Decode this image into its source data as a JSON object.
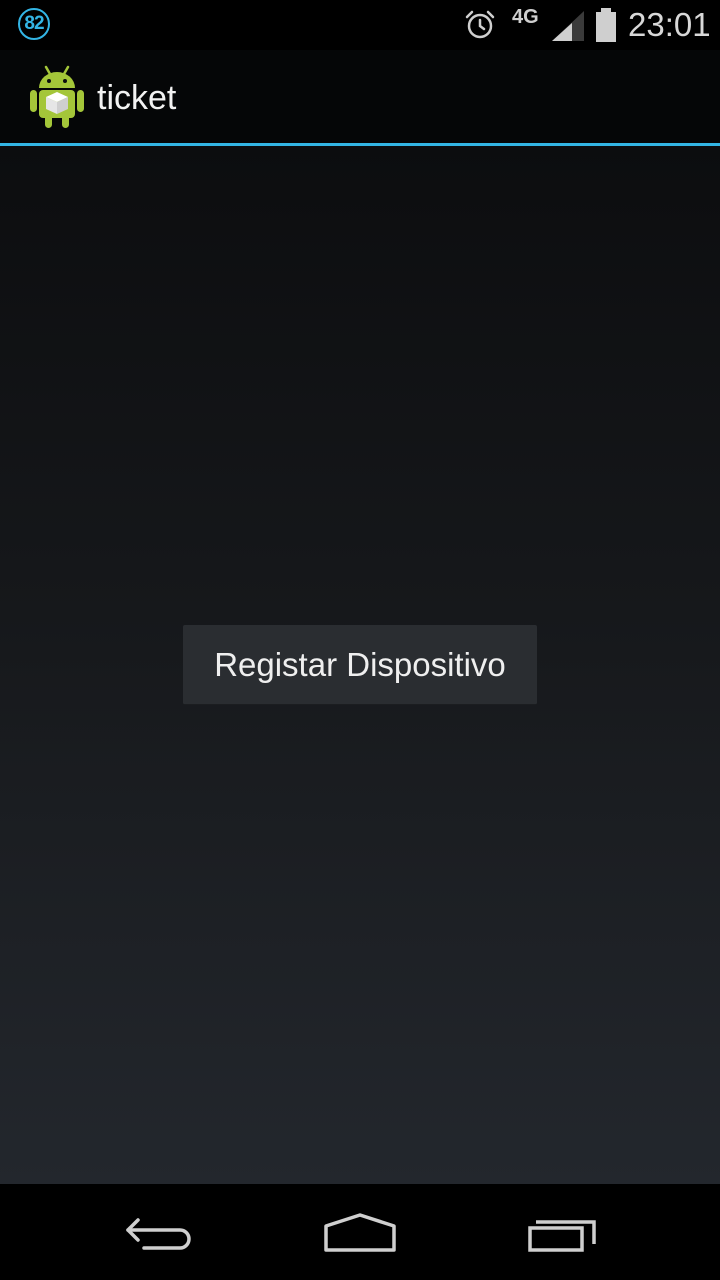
{
  "status_bar": {
    "notification_count": "82",
    "network_type": "4G",
    "time": "23:01",
    "icons": [
      "notification-badge",
      "alarm-icon",
      "signal-icon",
      "battery-icon"
    ]
  },
  "action_bar": {
    "app_icon": "android-app-icon",
    "title": "ticket"
  },
  "main": {
    "register_button_label": "Registar Dispositivo"
  },
  "nav_bar": {
    "icons": [
      "back-icon",
      "home-icon",
      "recents-icon"
    ]
  },
  "colors": {
    "accent": "#33b5e5",
    "android_green": "#a4c639",
    "background": "#000000"
  }
}
